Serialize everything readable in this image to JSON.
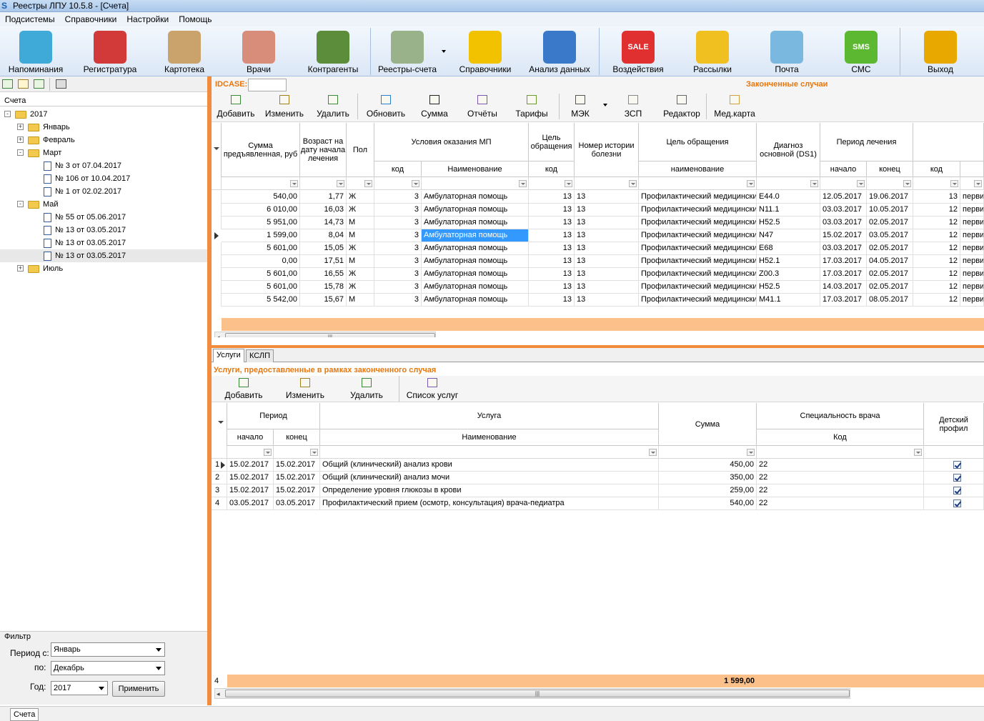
{
  "window": {
    "title": "Реестры ЛПУ 10.5.8 - [Счета]"
  },
  "menu": [
    "Подсистемы",
    "Справочники",
    "Настройки",
    "Помощь"
  ],
  "ribbon": [
    {
      "label": "Напоминания",
      "icon": "alarm-clock-icon",
      "color": "#3fa9d8"
    },
    {
      "label": "Регистратура",
      "icon": "receptionist-icon",
      "color": "#d23a3a"
    },
    {
      "label": "Картотека",
      "icon": "card-file-icon",
      "color": "#c9a36b"
    },
    {
      "label": "Врачи",
      "icon": "doctor-icon",
      "color": "#d88c7a"
    },
    {
      "label": "Контрагенты",
      "icon": "people-icon",
      "color": "#5b8d3a"
    },
    {
      "label": "Реестры-счета",
      "icon": "documents-coins-icon",
      "color": "#9ab28a"
    },
    {
      "label": "Справочники",
      "icon": "book-icon",
      "color": "#f2c200"
    },
    {
      "label": "Анализ данных",
      "icon": "rubik-cube-icon",
      "color": "#3a78c9"
    },
    {
      "label": "Воздействия",
      "icon": "sale-tag-icon",
      "color": "#e03030",
      "text": "SALE"
    },
    {
      "label": "Рассылки",
      "icon": "envelopes-icon",
      "color": "#f0c020"
    },
    {
      "label": "Почта",
      "icon": "mail-icon",
      "color": "#7ab8e0"
    },
    {
      "label": "СМС",
      "icon": "sms-bubble-icon",
      "color": "#5bb830",
      "text": "SMS"
    },
    {
      "label": "Выход",
      "icon": "exit-door-icon",
      "color": "#e8a800"
    }
  ],
  "left": {
    "header": "Счета",
    "tree": [
      {
        "label": "2017",
        "level": 0,
        "type": "folder",
        "exp": "-"
      },
      {
        "label": "Январь",
        "level": 1,
        "type": "folder",
        "exp": "+"
      },
      {
        "label": "Февраль",
        "level": 1,
        "type": "folder",
        "exp": "+"
      },
      {
        "label": "Март",
        "level": 1,
        "type": "folder",
        "exp": "-"
      },
      {
        "label": "№ 3 от 07.04.2017",
        "level": 2,
        "type": "doc"
      },
      {
        "label": "№ 106 от 10.04.2017",
        "level": 2,
        "type": "doc"
      },
      {
        "label": "№ 1 от 02.02.2017",
        "level": 2,
        "type": "doc"
      },
      {
        "label": "Май",
        "level": 1,
        "type": "folder",
        "exp": "-"
      },
      {
        "label": "№ 55 от 05.06.2017",
        "level": 2,
        "type": "doc"
      },
      {
        "label": "№ 13 от 03.05.2017",
        "level": 2,
        "type": "doc"
      },
      {
        "label": "№ 13 от 03.05.2017",
        "level": 2,
        "type": "doc"
      },
      {
        "label": "№ 13 от 03.05.2017",
        "level": 2,
        "type": "doc",
        "selected": true
      },
      {
        "label": "Июль",
        "level": 1,
        "type": "folder",
        "exp": "+"
      }
    ],
    "filter": {
      "title": "Фильтр",
      "from_label": "Период с:",
      "from": "Январь",
      "to_label": "по:",
      "to": "Декабрь",
      "year_label": "Год:",
      "year": "2017",
      "apply": "Применить"
    }
  },
  "top": {
    "idcase_label": "IDCASE:",
    "section_title": "Законченные случаи",
    "toolbar": [
      "Добавить",
      "Изменить",
      "Удалить",
      "Обновить",
      "Сумма",
      "Отчёты",
      "Тарифы",
      "МЭК",
      "ЗСП",
      "Редактор",
      "Мед.карта"
    ],
    "headers": {
      "sum": "Сумма предъявленная, руб",
      "age": "Возраст на дату начала лечения",
      "sex": "Пол",
      "cond": "Условия оказания МП",
      "cond_code": "код",
      "cond_name": "Наименование",
      "goal": "Цель обращения",
      "goal_code": "код",
      "history": "Номер истории болезни",
      "purpose": "Цель обращения",
      "purpose_name": "наименование",
      "diag": "Диагноз основной (DS1)",
      "period": "Период лечения",
      "start": "начало",
      "end": "конец",
      "code": "код"
    },
    "rows": [
      [
        "540,00",
        "1,77",
        "Ж",
        "3",
        "Амбулаторная помощь",
        "13",
        "13",
        "Профилактический медицински",
        "E44.0",
        "12.05.2017",
        "19.06.2017",
        "13",
        "первич"
      ],
      [
        "6 010,00",
        "16,03",
        "Ж",
        "3",
        "Амбулаторная помощь",
        "13",
        "13",
        "Профилактический медицински",
        "N11.1",
        "03.03.2017",
        "10.05.2017",
        "12",
        "первич"
      ],
      [
        "5 951,00",
        "14,73",
        "М",
        "3",
        "Амбулаторная помощь",
        "13",
        "13",
        "Профилактический медицински",
        "H52.5",
        "03.03.2017",
        "02.05.2017",
        "12",
        "первич"
      ],
      [
        "1 599,00",
        "8,04",
        "М",
        "3",
        "Амбулаторная помощь",
        "13",
        "13",
        "Профилактический медицински",
        "N47",
        "15.02.2017",
        "03.05.2017",
        "12",
        "первич"
      ],
      [
        "5 601,00",
        "15,05",
        "Ж",
        "3",
        "Амбулаторная помощь",
        "13",
        "13",
        "Профилактический медицински",
        "E68",
        "03.03.2017",
        "02.05.2017",
        "12",
        "первич"
      ],
      [
        "0,00",
        "17,51",
        "М",
        "3",
        "Амбулаторная помощь",
        "13",
        "13",
        "Профилактический медицински",
        "H52.1",
        "17.03.2017",
        "04.05.2017",
        "12",
        "первич"
      ],
      [
        "5 601,00",
        "16,55",
        "Ж",
        "3",
        "Амбулаторная помощь",
        "13",
        "13",
        "Профилактический медицински",
        "Z00.3",
        "17.03.2017",
        "02.05.2017",
        "12",
        "первич"
      ],
      [
        "5 601,00",
        "15,78",
        "Ж",
        "3",
        "Амбулаторная помощь",
        "13",
        "13",
        "Профилактический медицински",
        "H52.5",
        "14.03.2017",
        "02.05.2017",
        "12",
        "первич"
      ],
      [
        "5 542,00",
        "15,67",
        "М",
        "3",
        "Амбулаторная помощь",
        "13",
        "13",
        "Профилактический медицински",
        "M41.1",
        "17.03.2017",
        "08.05.2017",
        "12",
        "первич"
      ]
    ],
    "selected_row": 3
  },
  "bottom": {
    "tabs": [
      "Услуги",
      "КСЛП"
    ],
    "section_title": "Услуги, предоставленные в рамках законченного случая",
    "toolbar": [
      "Добавить",
      "Изменить",
      "Удалить",
      "Список услуг"
    ],
    "headers": {
      "period": "Период",
      "start": "начало",
      "end": "конец",
      "service": "Услуга",
      "name": "Наименование",
      "sum": "Сумма",
      "spec": "Специальность врача",
      "code": "Код",
      "child": "Детский профил"
    },
    "rows": [
      [
        "1",
        "15.02.2017",
        "15.02.2017",
        "Общий (клинический) анализ крови",
        "450,00",
        "22"
      ],
      [
        "2",
        "15.02.2017",
        "15.02.2017",
        "Общий (клинический) анализ мочи",
        "350,00",
        "22"
      ],
      [
        "3",
        "15.02.2017",
        "15.02.2017",
        "Определение уровня глюкозы в крови",
        "259,00",
        "22"
      ],
      [
        "4",
        "03.05.2017",
        "03.05.2017",
        "Профилактический прием (осмотр, консультация) врача-педиатра",
        "540,00",
        "22"
      ]
    ],
    "footer_count": "4",
    "footer_sum": "1 599,00"
  },
  "status": {
    "tab": "Счета"
  }
}
